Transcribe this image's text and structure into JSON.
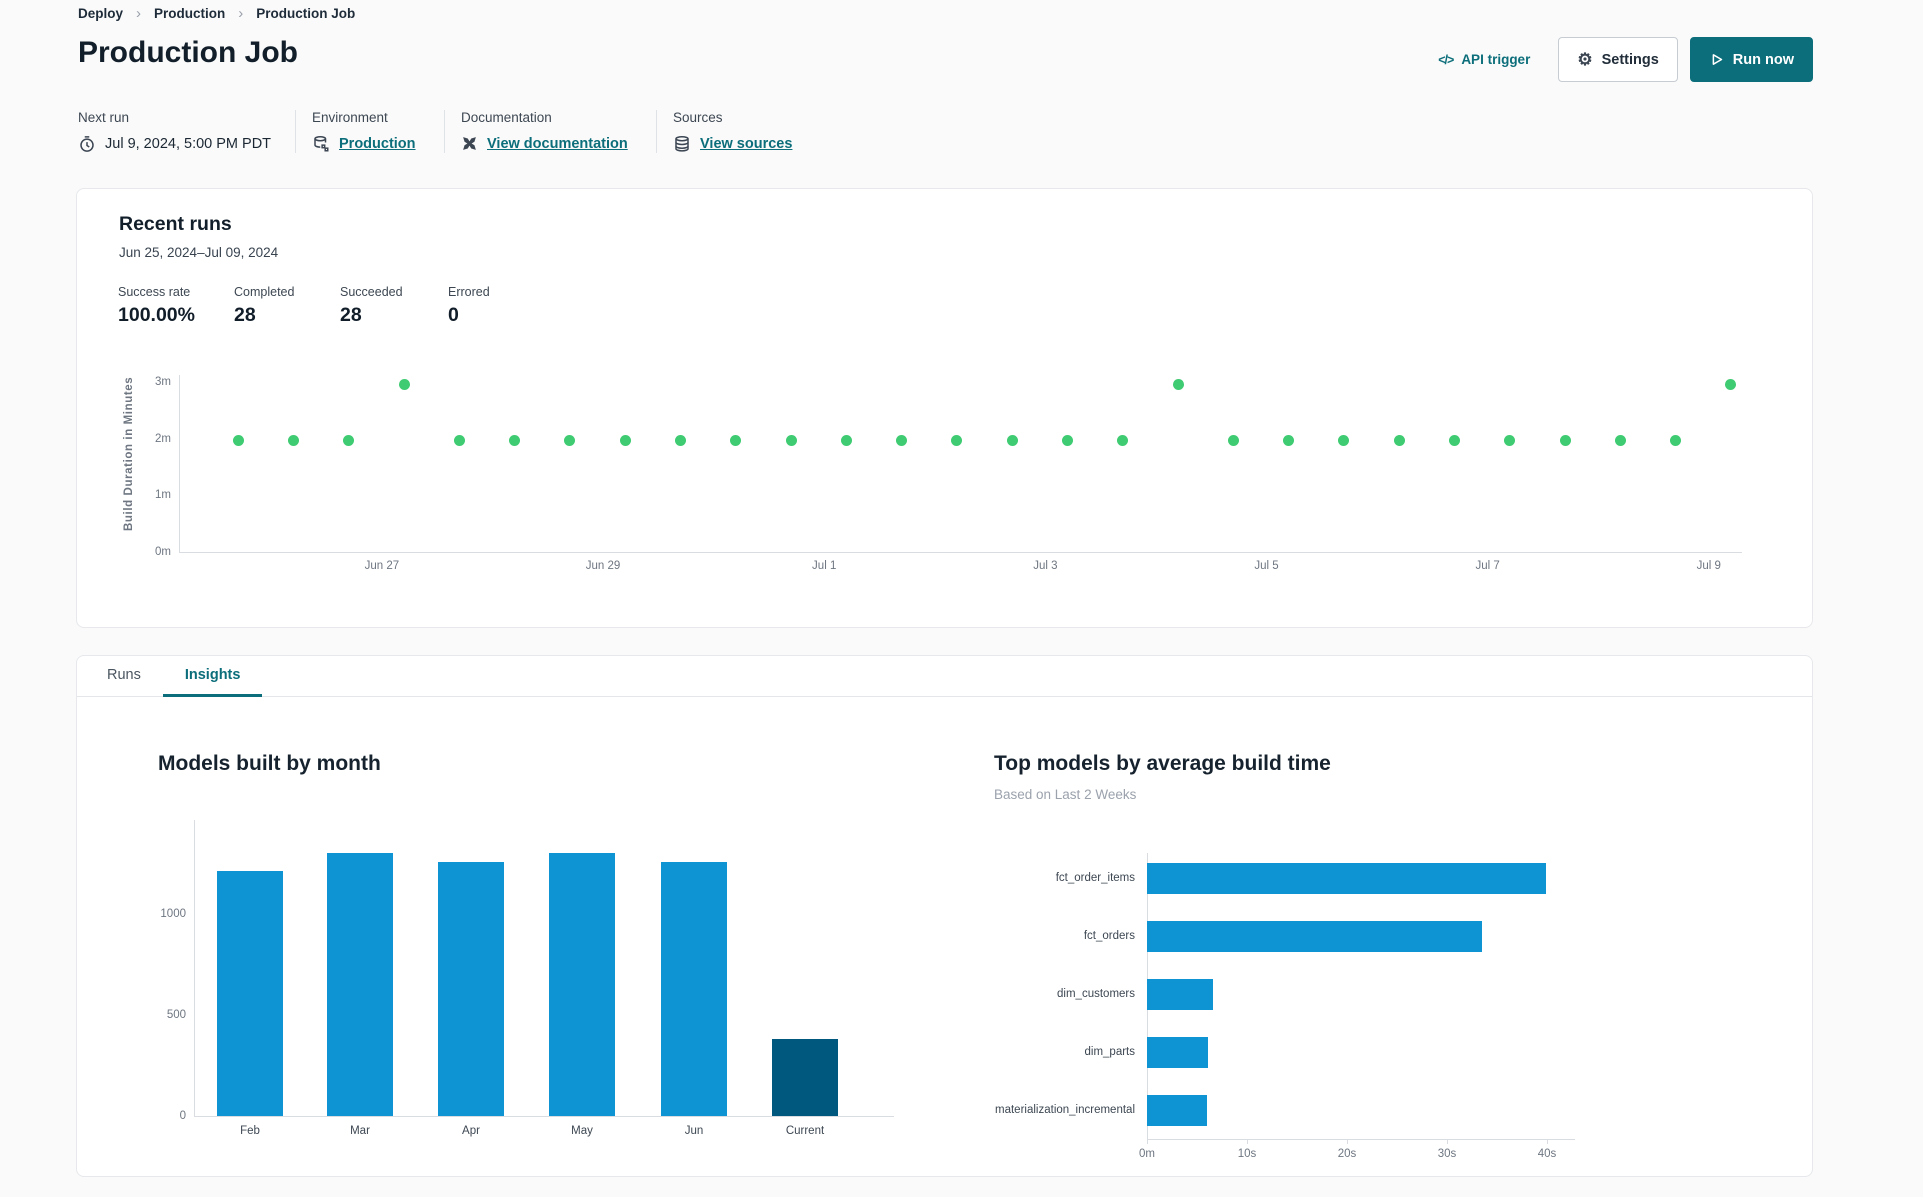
{
  "breadcrumb": {
    "items": [
      "Deploy",
      "Production",
      "Production Job"
    ]
  },
  "header": {
    "title": "Production Job",
    "api_trigger_label": "API trigger",
    "settings_label": "Settings",
    "run_now_label": "Run now"
  },
  "meta": [
    {
      "label": "Next run",
      "value": "Jul 9, 2024, 5:00 PM PDT",
      "icon": "clock-icon",
      "is_link": false
    },
    {
      "label": "Environment",
      "value": "Production",
      "icon": "database-icon",
      "is_link": true
    },
    {
      "label": "Documentation",
      "value": "View documentation",
      "icon": "dbt-icon",
      "is_link": true
    },
    {
      "label": "Sources",
      "value": "View sources",
      "icon": "sources-icon",
      "is_link": true
    }
  ],
  "recent_runs": {
    "title": "Recent runs",
    "date_range": "Jun 25, 2024–Jul 09, 2024",
    "stats": [
      {
        "label": "Success rate",
        "value": "100.00%"
      },
      {
        "label": "Completed",
        "value": "28"
      },
      {
        "label": "Succeeded",
        "value": "28"
      },
      {
        "label": "Errored",
        "value": "0"
      }
    ]
  },
  "tabs": [
    {
      "label": "Runs",
      "active": false
    },
    {
      "label": "Insights",
      "active": true
    }
  ],
  "colors": {
    "accent_teal": "#0c6e7a",
    "dot_green": "#3ecb71",
    "bar_blue": "#0e94d2",
    "bar_dark_blue": "#01587e",
    "axis_line": "#d9dce1"
  },
  "chart_data": [
    {
      "id": "build-duration-scatter",
      "type": "scatter",
      "ylabel": "Build Duration in Minutes",
      "x_unit": "days since Jun 25, 2024",
      "x": [
        0.7,
        1.2,
        1.7,
        2.2,
        2.7,
        3.2,
        3.7,
        4.2,
        4.7,
        5.2,
        5.7,
        6.2,
        6.7,
        7.2,
        7.7,
        8.2,
        8.7,
        9.2,
        9.7,
        10.2,
        10.7,
        11.2,
        11.7,
        12.2,
        12.7,
        13.2,
        13.7,
        14.2
      ],
      "y": [
        1.96,
        1.96,
        1.96,
        2.95,
        1.96,
        1.96,
        1.96,
        1.96,
        1.96,
        1.96,
        1.96,
        1.96,
        1.96,
        1.96,
        1.96,
        1.96,
        1.96,
        2.95,
        1.96,
        1.96,
        1.96,
        1.96,
        1.96,
        1.96,
        1.96,
        1.96,
        1.96,
        2.95
      ],
      "xlim": [
        0.165,
        14.3
      ],
      "ylim": [
        0,
        3.12
      ],
      "xticks": [
        {
          "pos": 2,
          "label": "Jun 27"
        },
        {
          "pos": 4,
          "label": "Jun 29"
        },
        {
          "pos": 6,
          "label": "Jul 1"
        },
        {
          "pos": 8,
          "label": "Jul 3"
        },
        {
          "pos": 10,
          "label": "Jul 5"
        },
        {
          "pos": 12,
          "label": "Jul 7"
        },
        {
          "pos": 14,
          "label": "Jul 9"
        }
      ],
      "yticks": [
        {
          "pos": 0,
          "label": "0m"
        },
        {
          "pos": 1,
          "label": "1m"
        },
        {
          "pos": 2,
          "label": "2m"
        },
        {
          "pos": 3,
          "label": "3m"
        }
      ],
      "point_color": "#3ecb71",
      "grid": false
    },
    {
      "id": "models-built-by-month",
      "type": "bar",
      "title": "Models built by month",
      "categories": [
        "Feb",
        "Mar",
        "Apr",
        "May",
        "Jun",
        "Current"
      ],
      "values": [
        1212,
        1300,
        1255,
        1300,
        1255,
        380
      ],
      "bar_colors": [
        "#0e94d2",
        "#0e94d2",
        "#0e94d2",
        "#0e94d2",
        "#0e94d2",
        "#01587e"
      ],
      "yticks": [
        {
          "pos": 0,
          "label": "0"
        },
        {
          "pos": 500,
          "label": "500"
        },
        {
          "pos": 1000,
          "label": "1000"
        }
      ],
      "ylim": [
        0,
        1430
      ],
      "grid": false
    },
    {
      "id": "top-models-by-avg-build-time",
      "type": "bar-horizontal",
      "title": "Top models by average build time",
      "subtitle": "Based on Last 2 Weeks",
      "categories": [
        "fct_order_items",
        "fct_orders",
        "dim_customers",
        "dim_parts",
        "materialization_incremental"
      ],
      "values": [
        39.9,
        33.5,
        6.6,
        6.1,
        6.0
      ],
      "value_unit": "seconds",
      "xticks": [
        {
          "pos": 0,
          "label": "0m"
        },
        {
          "pos": 10,
          "label": "10s"
        },
        {
          "pos": 20,
          "label": "20s"
        },
        {
          "pos": 30,
          "label": "30s"
        },
        {
          "pos": 40,
          "label": "40s"
        }
      ],
      "xlim": [
        0,
        42.5
      ],
      "bar_color": "#0e94d2",
      "grid": false
    }
  ]
}
